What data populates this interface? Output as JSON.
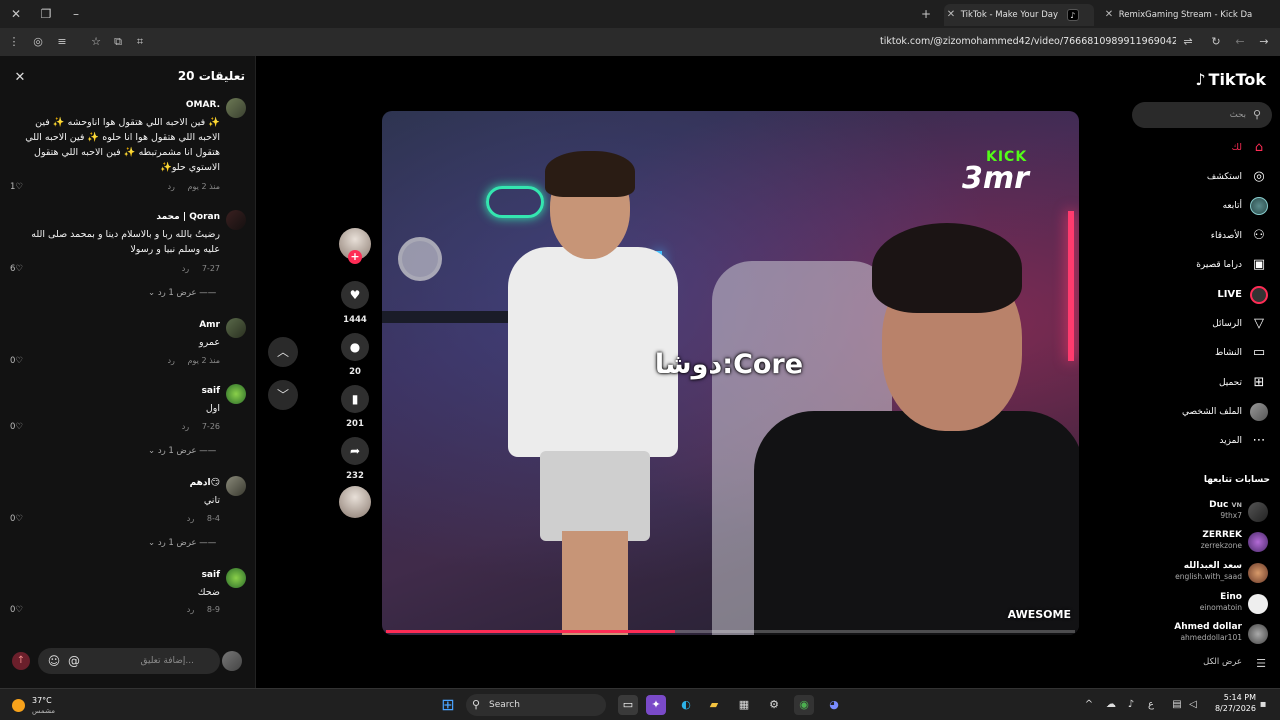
{
  "browser": {
    "tabs": [
      {
        "title": "TikTok - Make Your Day",
        "favicon": "tiktok-icon",
        "active": true
      },
      {
        "title": "RemixGaming Stream - Kick Da",
        "favicon": "kick-icon",
        "active": false
      }
    ],
    "url": "tiktok.com/@zizomohammed42/video/7666810989911969042"
  },
  "comments": {
    "title": "تعليقات 20",
    "input_placeholder": "إضافة تعليق...",
    "items": [
      {
        "user": "OMAR.",
        "text": "✨ فين الاحبه اللي هتقول هوا اناوحشه ✨ فين الاحبه اللي هتقول هوا انا حلوه ✨ فين الاحبه اللي هتقول انا مشمرتبطه ✨ فين الاحبه اللي هتقول الاستوي حلو✨",
        "time": "منذ 2 يوم",
        "reply": "رد",
        "likes": "1"
      },
      {
        "user": "محمد | Qoran",
        "text": "رضيتُ بالله ربا و بالاسلام دينا و بمحمد صلى الله عليه وسلم نبيا و رسولا",
        "time": "7-27",
        "reply": "رد",
        "likes": "6",
        "replies_label": "عرض 1 رد"
      },
      {
        "user": "Amr",
        "text": "عمرو",
        "time": "منذ 2 يوم",
        "reply": "رد",
        "likes": "0"
      },
      {
        "user": "saif",
        "text": "اول",
        "time": "7-26",
        "reply": "رد",
        "likes": "0",
        "replies_label": "عرض 1 رد"
      },
      {
        "user": "ادهم😏",
        "text": "تاني",
        "time": "8-4",
        "reply": "رد",
        "likes": "0",
        "replies_label": "عرض 1 رد"
      },
      {
        "user": "saif",
        "text": "ضحك",
        "time": "8-9",
        "reply": "رد",
        "likes": "0"
      }
    ]
  },
  "actions": {
    "likes": "1444",
    "comments": "20",
    "saves": "201",
    "shares": "232"
  },
  "video": {
    "overlay_text": "دوشا:Core",
    "logo_top": "KICK",
    "logo_main": "3mr",
    "watermark": "AWESOME",
    "progress": 0.42
  },
  "sidebar": {
    "brand": "TikTok",
    "search_placeholder": "بحث",
    "nav": [
      {
        "label": "لك",
        "icon": "home-icon",
        "active": true
      },
      {
        "label": "استكشف",
        "icon": "compass-icon"
      },
      {
        "label": "أتابعه",
        "icon": "following-avatar-icon"
      },
      {
        "label": "الأصدقاء",
        "icon": "friends-icon"
      },
      {
        "label": "دراما قصيرة",
        "icon": "film-icon"
      },
      {
        "label": "LIVE",
        "icon": "live-icon"
      },
      {
        "label": "الرسائل",
        "icon": "send-icon"
      },
      {
        "label": "النشاط",
        "icon": "message-icon"
      },
      {
        "label": "تحميل",
        "icon": "upload-icon"
      },
      {
        "label": "الملف الشخصي",
        "icon": "profile-avatar-icon"
      },
      {
        "label": "المزيد",
        "icon": "more-icon"
      }
    ],
    "following_title": "حسابات تتابعها",
    "following": [
      {
        "name": "Duc",
        "badge": "VN",
        "handle": "9thx7"
      },
      {
        "name": "ZERREK",
        "handle": "zerrekzone"
      },
      {
        "name": "سعد العبدالله",
        "handle": "english.with_saad"
      },
      {
        "name": "Eino",
        "handle": "einomatoin"
      },
      {
        "name": "Ahmed dollar",
        "handle": "ahmeddollar101"
      }
    ],
    "see_all": "عرض الكل"
  },
  "taskbar": {
    "weather_temp": "37°C",
    "weather_desc": "مشمس",
    "search_label": "Search",
    "time": "5:14 PM",
    "date": "8/27/2026",
    "lang": "ع"
  },
  "colors": {
    "accent": "#fe2c55",
    "kick_green": "#53fc18",
    "sidebar_bg": "#121212"
  }
}
